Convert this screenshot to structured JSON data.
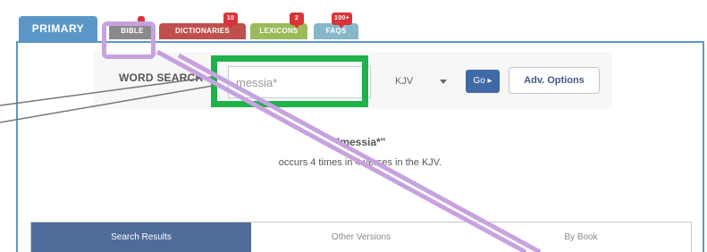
{
  "tabs": [
    {
      "label": "PRIMARY",
      "badge": ""
    },
    {
      "label": "BIBLE",
      "badge": ""
    },
    {
      "label": "DICTIONARIES",
      "badge": "10"
    },
    {
      "label": "LEXICONS",
      "badge": "2"
    },
    {
      "label": "FAQS",
      "badge": "100+"
    }
  ],
  "search": {
    "label": "WORD SEARCH",
    "value": "messia*",
    "version": "KJV",
    "go_label": "Go ▸",
    "adv_label": "Adv. Options"
  },
  "results": {
    "term": "\"messia*\"",
    "summary": "occurs 4 times in 4 verses in the KJV."
  },
  "subtabs": [
    "Search Results",
    "Other Versions",
    "By Book"
  ],
  "colors": {
    "primary_tab": "#5b96c8",
    "go_button": "#3f6aa6",
    "highlight_green": "#1fb14a",
    "highlight_purple": "#c7a2e0"
  }
}
